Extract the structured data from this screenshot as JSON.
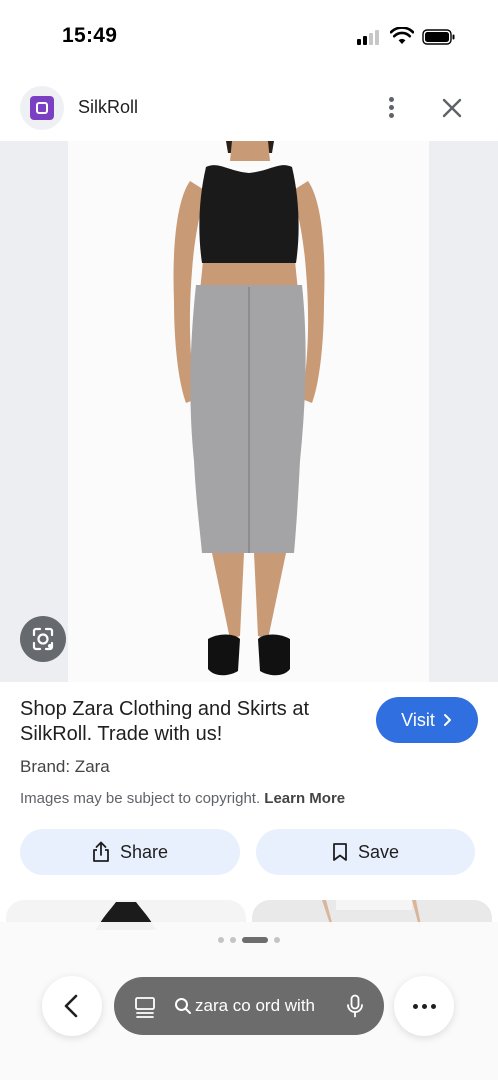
{
  "status_bar": {
    "time": "15:49"
  },
  "header": {
    "site_name": "SilkRoll",
    "logo_icon": "silkroll-logo-icon"
  },
  "result": {
    "title": "Shop Zara Clothing and Skirts at SilkRoll. Trade with us!",
    "visit_label": "Visit",
    "brand": "Brand: Zara",
    "copyright_notice": "Images may be subject to copyright.",
    "learn_more": "Learn More",
    "share_label": "Share",
    "save_label": "Save"
  },
  "search_bar": {
    "query": "zara co ord with"
  },
  "colors": {
    "visit_button": "#2f6fdf",
    "action_buttons": "#e8f0fe",
    "logo": "#7b3fc4",
    "search_pill": "#6c6c6c"
  }
}
